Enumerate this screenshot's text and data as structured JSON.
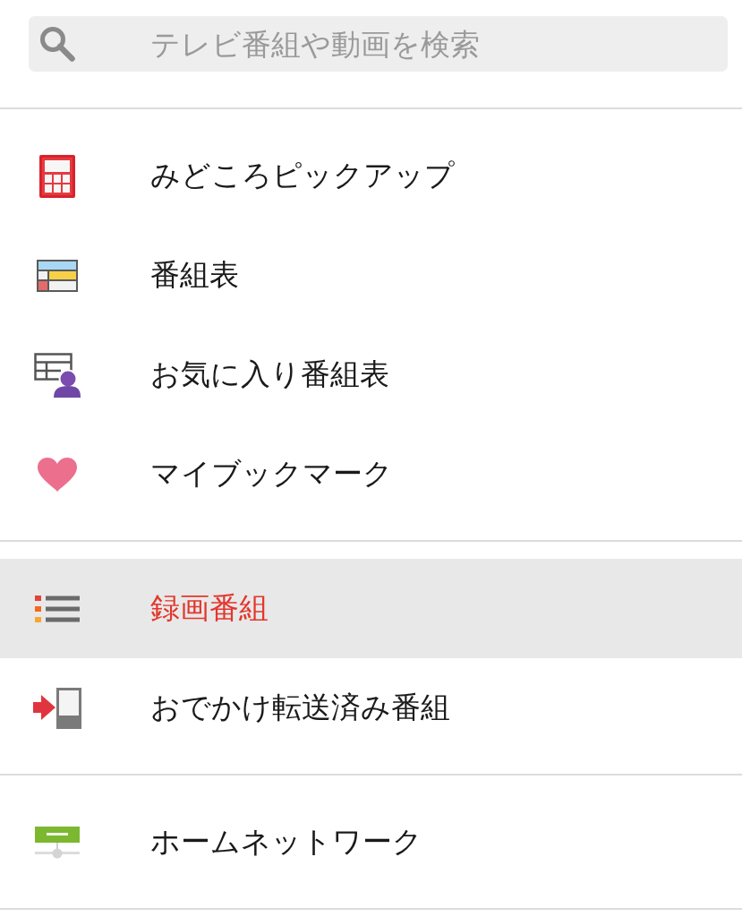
{
  "search": {
    "placeholder": "テレビ番組や動画を検索"
  },
  "menu_groups": [
    {
      "items": [
        {
          "label": "みどころピックアップ",
          "selected": false
        },
        {
          "label": "番組表",
          "selected": false
        },
        {
          "label": "お気に入り番組表",
          "selected": false
        },
        {
          "label": "マイブックマーク",
          "selected": false
        }
      ]
    },
    {
      "items": [
        {
          "label": "録画番組",
          "selected": true
        },
        {
          "label": "おでかけ転送済み番組",
          "selected": false
        }
      ]
    },
    {
      "items": [
        {
          "label": "ホームネットワーク",
          "selected": false
        }
      ]
    }
  ]
}
